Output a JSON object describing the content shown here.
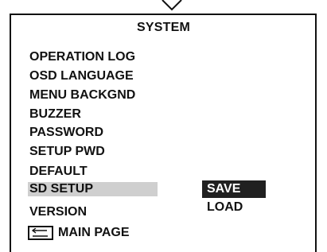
{
  "menu": {
    "title": "SYSTEM",
    "items": [
      {
        "label": "OPERATION LOG"
      },
      {
        "label": "OSD LANGUAGE"
      },
      {
        "label": "MENU BACKGND"
      },
      {
        "label": "BUZZER"
      },
      {
        "label": "PASSWORD"
      },
      {
        "label": "SETUP PWD"
      },
      {
        "label": "DEFAULT"
      },
      {
        "label": "SD SETUP",
        "selected": true
      },
      {
        "label": "VERSION"
      }
    ],
    "submenu": [
      {
        "label": "SAVE",
        "active": true
      },
      {
        "label": "LOAD"
      }
    ],
    "main_page": {
      "label": "MAIN PAGE",
      "icon": "return-icon"
    }
  },
  "colors": {
    "selected_item_bg": "#cfcfcf",
    "active_submenu_bg": "#202020",
    "active_submenu_text": "#ffffff",
    "text": "#111111",
    "background": "#ffffff"
  }
}
